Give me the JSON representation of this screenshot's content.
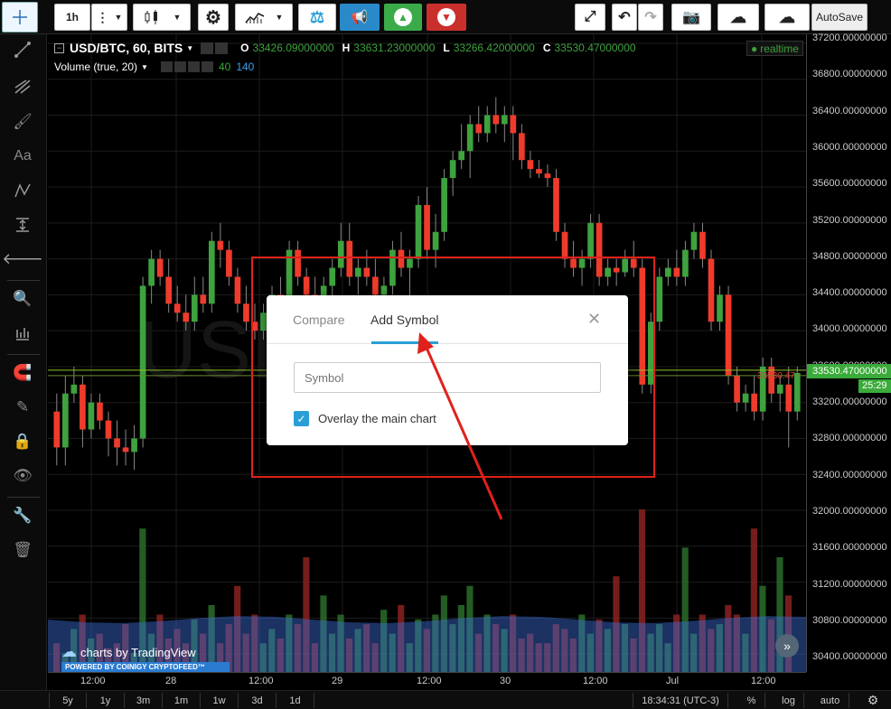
{
  "toolbar": {
    "interval": "1h",
    "autosave": "AutoSave"
  },
  "legend": {
    "symbol": "USD/BTC, 60, BITS",
    "o_label": "O",
    "o_value": "33426.09000000",
    "h_label": "H",
    "h_value": "33631.23000000",
    "l_label": "L",
    "l_value": "33266.42000000",
    "c_label": "C",
    "c_value": "33530.47000000",
    "realtime": "realtime",
    "volume": "Volume (true, 20)",
    "vol_a": "40",
    "vol_b": "140"
  },
  "price_axis": {
    "labels": [
      "37200.00000000",
      "36800.00000000",
      "36400.00000000",
      "36000.00000000",
      "35600.00000000",
      "35200.00000000",
      "34800.00000000",
      "34400.00000000",
      "34000.00000000",
      "33600.00000000",
      "33200.00000000",
      "32800.00000000",
      "32400.00000000",
      "32000.00000000",
      "31600.00000000",
      "31200.00000000",
      "30800.00000000",
      "30400.00000000"
    ],
    "current_price": "33530.47000000",
    "countdown": "25:29",
    "left_price": "33530.47"
  },
  "time_axis": {
    "labels": [
      "12:00",
      "28",
      "12:00",
      "29",
      "12:00",
      "30",
      "12:00",
      "Jul",
      "12:00"
    ]
  },
  "bottom": {
    "ranges": [
      "5y",
      "1y",
      "3m",
      "1m",
      "1w",
      "3d",
      "1d"
    ],
    "clock": "18:34:31 (UTC-3)",
    "percent": "%",
    "log": "log",
    "auto": "auto"
  },
  "watermark": {
    "brand": "charts by TradingView",
    "powered": "POWERED BY COINIGY CRYPTOFEED™"
  },
  "dialog": {
    "tab_compare": "Compare",
    "tab_add_symbol": "Add Symbol",
    "active_tab": "Add Symbol",
    "symbol_placeholder": "Symbol",
    "symbol_value": "",
    "overlay_label": "Overlay the main chart",
    "overlay_checked": true,
    "close": "✕"
  },
  "colors": {
    "up": "#3ea23e",
    "down": "#ef3b2c",
    "accent": "#2a9fd6",
    "annotation": "#e0211b",
    "current_price_bg": "#3aab3a"
  },
  "chart_data": {
    "type": "candlestick",
    "ylim": [
      30200,
      37300
    ],
    "candles": [
      [
        33100,
        33300,
        32500,
        32700
      ],
      [
        32700,
        33500,
        32500,
        33300
      ],
      [
        33300,
        33600,
        33200,
        33400
      ],
      [
        33400,
        33500,
        32700,
        32900
      ],
      [
        32900,
        33300,
        32800,
        33200
      ],
      [
        33200,
        33300,
        32900,
        33000
      ],
      [
        33000,
        33100,
        32600,
        32800
      ],
      [
        32800,
        33000,
        32500,
        32700
      ],
      [
        32700,
        32900,
        32500,
        32650
      ],
      [
        32650,
        32950,
        32450,
        32800
      ],
      [
        32800,
        34600,
        32700,
        34500
      ],
      [
        34500,
        34900,
        34300,
        34800
      ],
      [
        34800,
        34900,
        34500,
        34600
      ],
      [
        34600,
        34800,
        34200,
        34300
      ],
      [
        34300,
        34500,
        34100,
        34200
      ],
      [
        34200,
        34400,
        34000,
        34100
      ],
      [
        34100,
        34600,
        34000,
        34400
      ],
      [
        34400,
        34600,
        34200,
        34300
      ],
      [
        34300,
        35100,
        34200,
        35000
      ],
      [
        35000,
        35200,
        34700,
        34900
      ],
      [
        34900,
        35000,
        34500,
        34600
      ],
      [
        34600,
        34700,
        34200,
        34300
      ],
      [
        34300,
        34500,
        34000,
        34100
      ],
      [
        34100,
        34300,
        33900,
        34000
      ],
      [
        34000,
        34300,
        33900,
        34200
      ],
      [
        34200,
        34500,
        34100,
        34400
      ],
      [
        34400,
        34600,
        34200,
        34300
      ],
      [
        34300,
        35000,
        34200,
        34900
      ],
      [
        34900,
        35000,
        34500,
        34600
      ],
      [
        34600,
        34700,
        34300,
        34400
      ],
      [
        34400,
        34600,
        34200,
        34300
      ],
      [
        34300,
        34600,
        34200,
        34500
      ],
      [
        34500,
        34800,
        34300,
        34700
      ],
      [
        34700,
        35200,
        34600,
        35000
      ],
      [
        35000,
        35200,
        34500,
        34600
      ],
      [
        34600,
        34800,
        34400,
        34700
      ],
      [
        34700,
        34900,
        34500,
        34600
      ],
      [
        34600,
        34800,
        34300,
        34400
      ],
      [
        34400,
        34600,
        34200,
        34500
      ],
      [
        34500,
        35000,
        34400,
        34900
      ],
      [
        34900,
        35100,
        34600,
        34700
      ],
      [
        34700,
        34900,
        34300,
        34800
      ],
      [
        34800,
        35500,
        34700,
        35400
      ],
      [
        35400,
        35600,
        34800,
        34900
      ],
      [
        34900,
        35300,
        34700,
        35100
      ],
      [
        35100,
        35800,
        35000,
        35700
      ],
      [
        35700,
        36000,
        35500,
        35900
      ],
      [
        35900,
        36300,
        35800,
        36000
      ],
      [
        36000,
        36400,
        35700,
        36300
      ],
      [
        36300,
        36500,
        36100,
        36200
      ],
      [
        36200,
        36500,
        36100,
        36400
      ],
      [
        36400,
        36600,
        36200,
        36300
      ],
      [
        36300,
        36500,
        36100,
        36400
      ],
      [
        36400,
        36500,
        35900,
        36200
      ],
      [
        36200,
        36300,
        35800,
        35900
      ],
      [
        35900,
        36000,
        35700,
        35800
      ],
      [
        35800,
        35900,
        35700,
        35750
      ],
      [
        35750,
        35850,
        35600,
        35700
      ],
      [
        35700,
        35800,
        35000,
        35100
      ],
      [
        35100,
        35200,
        34700,
        34800
      ],
      [
        34800,
        35000,
        34600,
        34700
      ],
      [
        34700,
        34900,
        34500,
        34800
      ],
      [
        34800,
        35300,
        34700,
        35200
      ],
      [
        35200,
        35300,
        34500,
        34600
      ],
      [
        34600,
        34800,
        34500,
        34700
      ],
      [
        34700,
        34800,
        34500,
        34650
      ],
      [
        34650,
        34900,
        34600,
        34800
      ],
      [
        34800,
        35000,
        34600,
        34700
      ],
      [
        34700,
        34800,
        33300,
        33400
      ],
      [
        33400,
        34200,
        33300,
        34100
      ],
      [
        34100,
        34700,
        34000,
        34600
      ],
      [
        34600,
        34800,
        34500,
        34700
      ],
      [
        34700,
        34900,
        34500,
        34600
      ],
      [
        34600,
        35000,
        34500,
        34900
      ],
      [
        34900,
        35200,
        34800,
        35100
      ],
      [
        35100,
        35200,
        34700,
        34800
      ],
      [
        34800,
        34900,
        34000,
        34100
      ],
      [
        34100,
        34500,
        34000,
        34400
      ],
      [
        34400,
        34500,
        33400,
        33500
      ],
      [
        33500,
        33600,
        33100,
        33200
      ],
      [
        33200,
        33400,
        33100,
        33300
      ],
      [
        33300,
        33500,
        33000,
        33100
      ],
      [
        33100,
        33700,
        33000,
        33600
      ],
      [
        33600,
        33700,
        33200,
        33300
      ],
      [
        33300,
        33500,
        33100,
        33400
      ],
      [
        33400,
        33600,
        32700,
        33100
      ],
      [
        33100,
        33600,
        33000,
        33530
      ]
    ],
    "volumes": [
      30,
      20,
      45,
      60,
      35,
      40,
      25,
      30,
      50,
      20,
      150,
      40,
      60,
      35,
      45,
      30,
      55,
      40,
      70,
      30,
      50,
      90,
      40,
      60,
      30,
      45,
      35,
      60,
      50,
      120,
      30,
      80,
      40,
      60,
      35,
      45,
      50,
      30,
      65,
      40,
      70,
      30,
      55,
      45,
      60,
      80,
      50,
      70,
      90,
      40,
      60,
      50,
      45,
      60,
      35,
      40,
      30,
      30,
      50,
      45,
      35,
      60,
      40,
      55,
      45,
      100,
      50,
      35,
      170,
      40,
      50,
      30,
      60,
      130,
      40,
      60,
      45,
      50,
      70,
      60,
      40,
      150,
      90,
      55,
      120,
      80
    ]
  }
}
